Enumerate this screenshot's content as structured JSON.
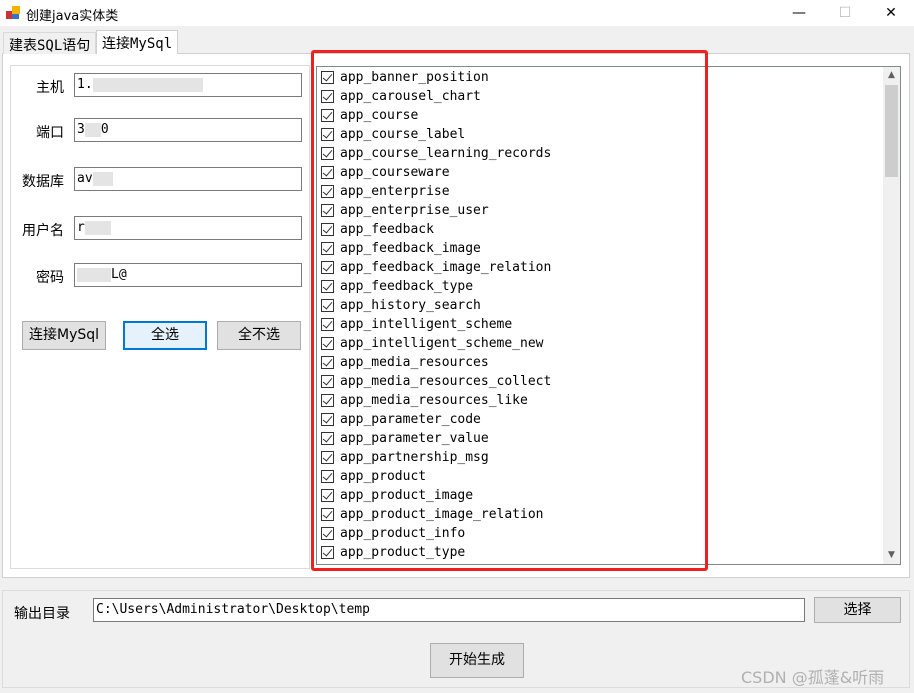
{
  "window": {
    "title": "创建java实体类",
    "minimize": "—",
    "maximize": "☐",
    "close": "✕"
  },
  "tabs": [
    {
      "label": "建表SQL语句"
    },
    {
      "label": "连接MySql",
      "active": true
    }
  ],
  "form": {
    "host": {
      "label": "主机",
      "value": "1."
    },
    "port": {
      "label": "端口",
      "value_start": "3",
      "value_end": "0"
    },
    "database": {
      "label": "数据库",
      "value": "av"
    },
    "username": {
      "label": "用户名",
      "value": "r"
    },
    "password": {
      "label": "密码",
      "value": "L@"
    }
  },
  "buttons": {
    "connect": "连接MySql",
    "select_all": "全选",
    "select_none": "全不选",
    "browse": "选择",
    "generate": "开始生成"
  },
  "tables": [
    "app_banner_position",
    "app_carousel_chart",
    "app_course",
    "app_course_label",
    "app_course_learning_records",
    "app_courseware",
    "app_enterprise",
    "app_enterprise_user",
    "app_feedback",
    "app_feedback_image",
    "app_feedback_image_relation",
    "app_feedback_type",
    "app_history_search",
    "app_intelligent_scheme",
    "app_intelligent_scheme_new",
    "app_media_resources",
    "app_media_resources_collect",
    "app_media_resources_like",
    "app_parameter_code",
    "app_parameter_value",
    "app_partnership_msg",
    "app_product",
    "app_product_image",
    "app_product_image_relation",
    "app_product_info",
    "app_product_type"
  ],
  "output": {
    "label": "输出目录",
    "value": "C:\\Users\\Administrator\\Desktop\\temp"
  },
  "watermark": "CSDN @孤蓬&听雨",
  "colors": {
    "highlight": "#f02020",
    "focus": "#0078d7"
  }
}
